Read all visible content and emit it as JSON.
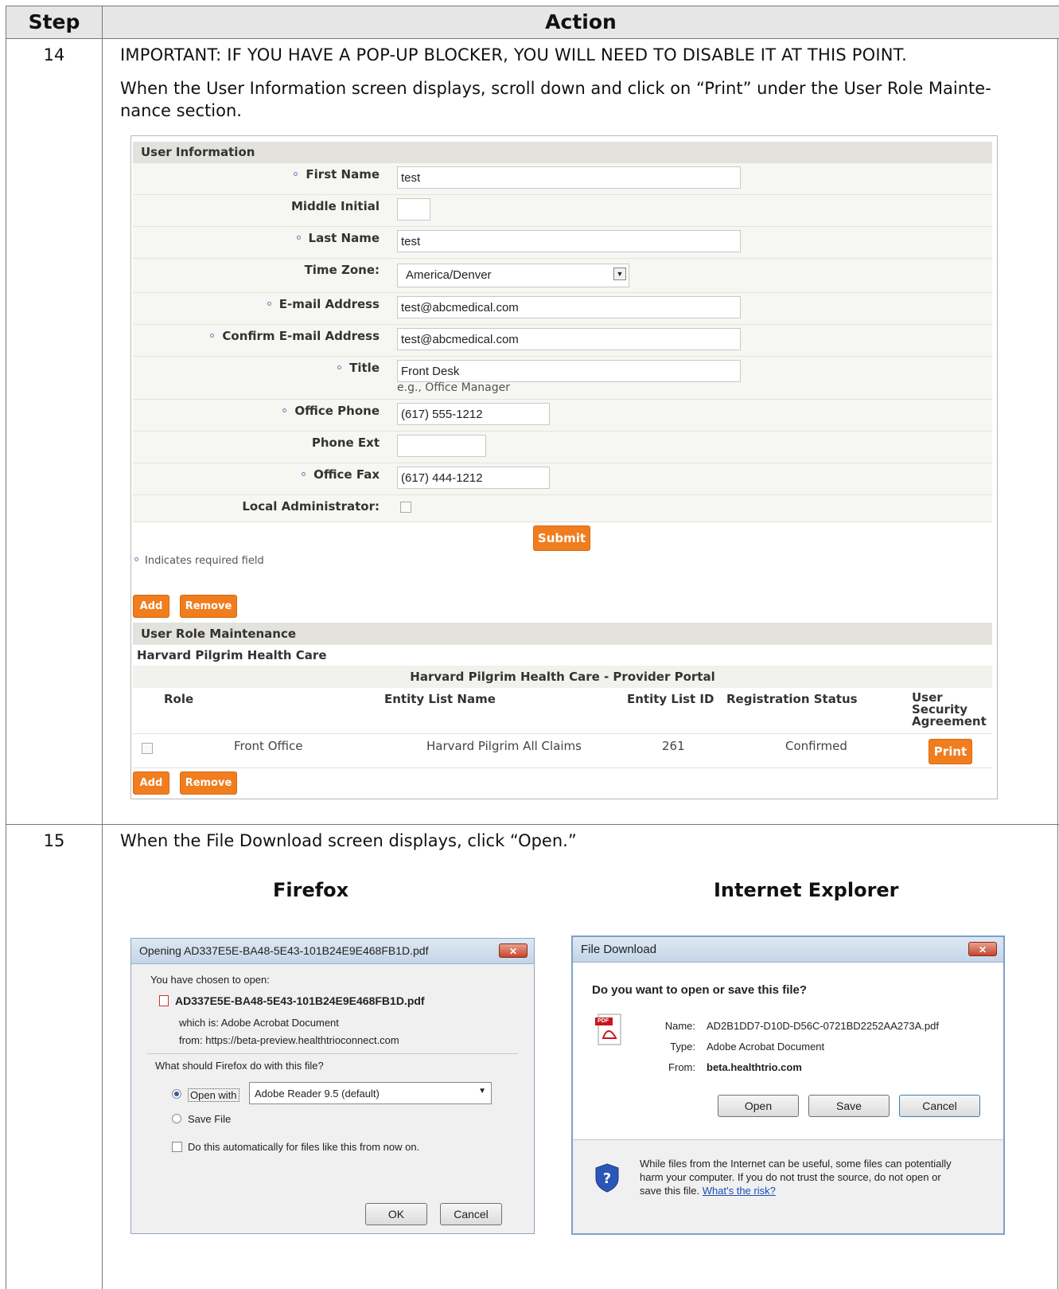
{
  "header": {
    "step": "Step",
    "action": "Action"
  },
  "step14": {
    "number": "14",
    "important": "IMPORTANT:  IF YOU HAVE A POP-UP BLOCKER, YOU WILL NEED TO DISABLE IT AT THIS POINT.",
    "instruction_line1": "When the User Information screen displays, scroll down and click on “Print” under the User Role Mainte-",
    "instruction_line2": "nance section."
  },
  "user_info": {
    "section_title": "User Information",
    "first_name_label": "First Name",
    "first_name_value": "test",
    "middle_initial_label": "Middle Initial",
    "middle_initial_value": "",
    "last_name_label": "Last Name",
    "last_name_value": "test",
    "time_zone_label": "Time Zone:",
    "time_zone_value": "America/Denver",
    "email_label": "E-mail Address",
    "email_value": "test@abcmedical.com",
    "confirm_email_label": "Confirm E-mail Address",
    "confirm_email_value": "test@abcmedical.com",
    "title_label": "Title",
    "title_value": "Front Desk",
    "title_hint": "e.g., Office Manager",
    "office_phone_label": "Office Phone",
    "office_phone_value": "(617) 555-1212",
    "phone_ext_label": "Phone Ext",
    "phone_ext_value": "",
    "office_fax_label": "Office Fax",
    "office_fax_value": "(617) 444-1212",
    "local_admin_label": "Local Administrator:",
    "local_admin_checked": false,
    "submit_label": "Submit",
    "required_note": "Indicates required field",
    "add_label": "Add",
    "remove_label": "Remove"
  },
  "role_maintenance": {
    "section_title": "User Role Maintenance",
    "organization": "Harvard Pilgrim Health Care",
    "portal_title": "Harvard Pilgrim Health Care - Provider Portal",
    "columns": {
      "role": "Role",
      "entity_list_name": "Entity List Name",
      "entity_list_id": "Entity List ID",
      "registration_status": "Registration Status",
      "agreement_line1": "User",
      "agreement_line2": "Security",
      "agreement_line3": "Agreement"
    },
    "row": {
      "role": "Front Office",
      "entity_list_name": "Harvard Pilgrim All Claims",
      "entity_list_id": "261",
      "registration_status": "Confirmed",
      "print_label": "Print"
    },
    "add_label": "Add",
    "remove_label": "Remove"
  },
  "step15": {
    "number": "15",
    "instruction": "When the File Download screen displays, click “Open.”",
    "firefox_heading": "Firefox",
    "ie_heading": "Internet Explorer"
  },
  "firefox_dialog": {
    "title": "Opening AD337E5E-BA48-5E43-101B24E9E468FB1D.pdf",
    "chosen": "You have chosen to open:",
    "filename": "AD337E5E-BA48-5E43-101B24E9E468FB1D.pdf",
    "which_is": "which is:  Adobe Acrobat Document",
    "from": "from:  https://beta-preview.healthtrioconnect.com",
    "question": "What should Firefox do with this file?",
    "open_with_label": "Open with",
    "open_with_app": "Adobe Reader 9.5 (default)",
    "save_file_label": "Save File",
    "auto_label": "Do this automatically for files like this from now on.",
    "ok_label": "OK",
    "cancel_label": "Cancel",
    "selected_option": "open_with"
  },
  "ie_dialog": {
    "title": "File Download",
    "question": "Do you want to open or save this file?",
    "name_label": "Name:",
    "name_value": "AD2B1DD7-D10D-D56C-0721BD2252AA273A.pdf",
    "type_label": "Type:",
    "type_value": "Adobe Acrobat Document",
    "from_label": "From:",
    "from_value": "beta.healthtrio.com",
    "open_label": "Open",
    "save_label": "Save",
    "cancel_label": "Cancel",
    "warning_line1": "While files from the Internet can be useful, some files can potentially",
    "warning_line2": "harm your computer. If you do not trust the source, do not open or",
    "warning_line3": "save this file.",
    "risk_link": "What's the risk?",
    "pdf_badge": "PDF"
  },
  "colors": {
    "accent_orange": "#f07d1e",
    "header_gray": "#e6e6e6",
    "section_band": "#e3e2dc",
    "link_blue": "#1a4fb5"
  }
}
